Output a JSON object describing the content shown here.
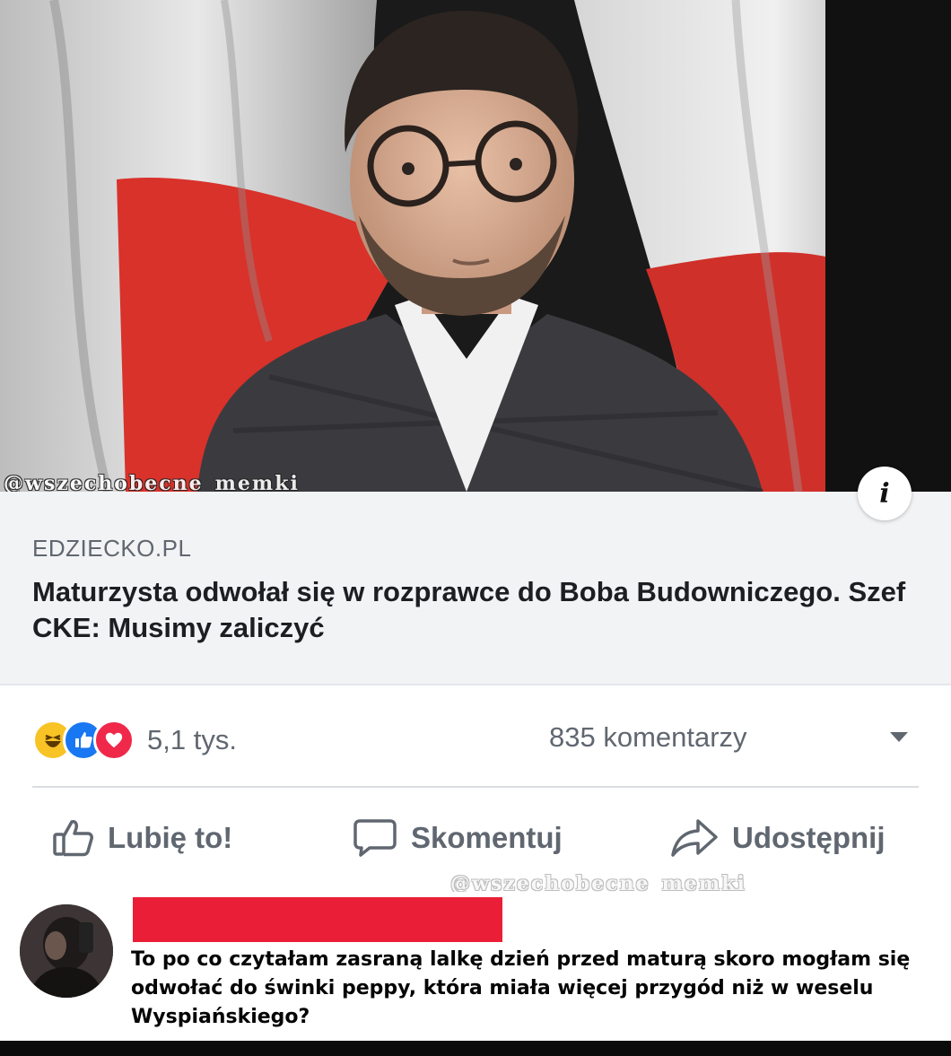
{
  "photo": {
    "watermark": "@wszechobecne_memki"
  },
  "link_preview": {
    "info_icon": "info-icon",
    "domain": "EDZIECKO.PL",
    "headline": "Maturzysta odwołał się w rozprawce do Boba Budowniczego. Szef CKE: Musimy zaliczyć"
  },
  "stats": {
    "reaction_icons": [
      "haha-reaction-icon",
      "like-reaction-icon",
      "love-reaction-icon"
    ],
    "reactions_count": "5,1 tys.",
    "comments_count": "835 komentarzy",
    "dropdown_icon": "caret-down-icon"
  },
  "actions": {
    "like_label": "Lubię to!",
    "comment_label": "Skomentuj",
    "share_label": "Udostępnij"
  },
  "share_watermark": "@wszechobecne_memki",
  "comment": {
    "author_redaction_color": "#ea1f37",
    "text": "To po co czytałam zasraną lalkę dzień przed maturą skoro mogłam się odwołać do świnki peppy, która miała więcej przygód niż w weselu Wyspiańskiego?"
  },
  "colors": {
    "like_blue": "#1877f2",
    "love_red": "#f0284a",
    "haha_yellow": "#f7c325",
    "flag_red": "#d8322b"
  }
}
